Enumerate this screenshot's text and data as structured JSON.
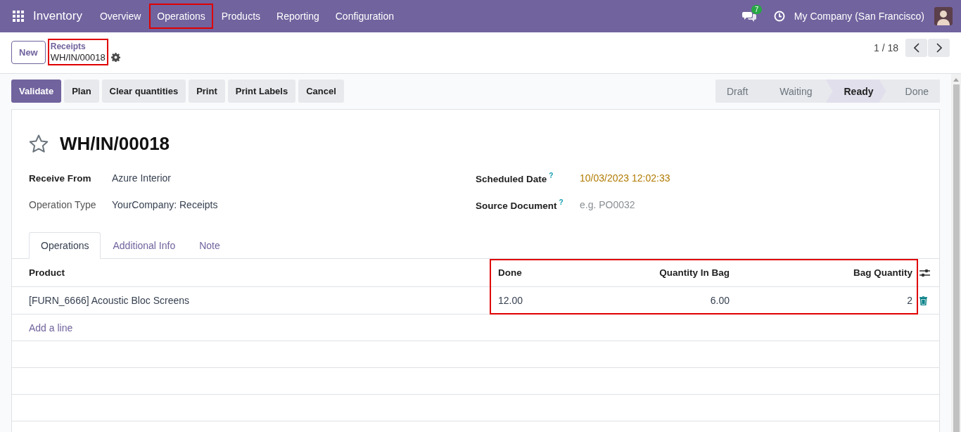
{
  "navbar": {
    "app_name": "Inventory",
    "menu": [
      {
        "label": "Overview",
        "highlighted": false
      },
      {
        "label": "Operations",
        "highlighted": true
      },
      {
        "label": "Products",
        "highlighted": false
      },
      {
        "label": "Reporting",
        "highlighted": false
      },
      {
        "label": "Configuration",
        "highlighted": false
      }
    ],
    "chat_badge": "7",
    "company": "My Company (San Francisco)"
  },
  "control_panel": {
    "new_button": "New",
    "breadcrumb": {
      "parent": "Receipts",
      "current": "WH/IN/00018",
      "highlighted": true
    },
    "pager": "1 / 18"
  },
  "actions": [
    {
      "label": "Validate",
      "primary": true
    },
    {
      "label": "Plan",
      "primary": false
    },
    {
      "label": "Clear quantities",
      "primary": false
    },
    {
      "label": "Print",
      "primary": false
    },
    {
      "label": "Print Labels",
      "primary": false
    },
    {
      "label": "Cancel",
      "primary": false
    }
  ],
  "stages": [
    {
      "label": "Draft",
      "selected": false
    },
    {
      "label": "Waiting",
      "selected": false
    },
    {
      "label": "Ready",
      "selected": true
    },
    {
      "label": "Done",
      "selected": false
    }
  ],
  "record": {
    "title": "WH/IN/00018",
    "starred": false,
    "left_fields": [
      {
        "label": "Receive From",
        "value": "Azure Interior",
        "required": true
      },
      {
        "label": "Operation Type",
        "value": "YourCompany: Receipts",
        "required": false
      }
    ],
    "right_fields": [
      {
        "label": "Scheduled Date",
        "help": "?",
        "value": "10/03/2023 12:02:33",
        "kind": "date"
      },
      {
        "label": "Source Document",
        "help": "?",
        "placeholder": "e.g. PO0032",
        "kind": "input"
      }
    ]
  },
  "tabs": [
    {
      "label": "Operations",
      "selected": true
    },
    {
      "label": "Additional Info",
      "selected": false
    },
    {
      "label": "Note",
      "selected": false
    }
  ],
  "table": {
    "columns": [
      {
        "label": "Product",
        "highlighted": false
      },
      {
        "label": "Done",
        "highlighted": true
      },
      {
        "label": "Quantity In Bag",
        "highlighted": true
      },
      {
        "label": "Bag Quantity",
        "highlighted": true
      }
    ],
    "rows": [
      [
        "[FURN_6666] Acoustic Bloc Screens",
        "12.00",
        "6.00",
        "2"
      ]
    ],
    "add_line": "Add a line"
  }
}
